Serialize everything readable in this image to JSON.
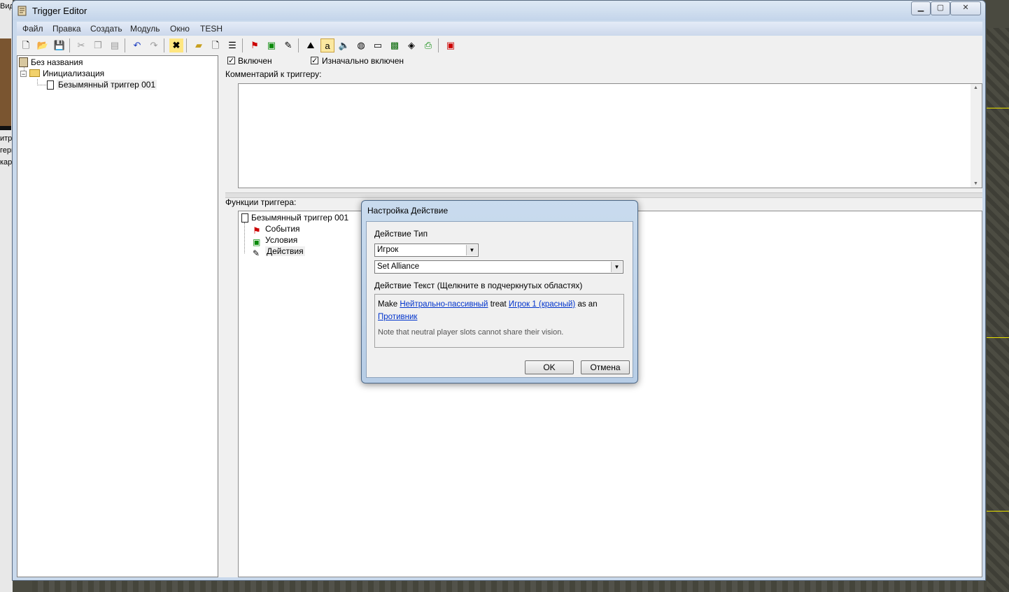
{
  "window": {
    "title": "Trigger Editor"
  },
  "menu": [
    "Файл",
    "Правка",
    "Создать",
    "Модуль",
    "Окно",
    "TESH"
  ],
  "background": {
    "left_labels": [
      "Вид",
      "итра",
      "герг",
      "кар"
    ]
  },
  "toolbar": {
    "icons": [
      "new-icon",
      "open-icon",
      "save-icon",
      "cut-icon",
      "copy-icon",
      "paste-icon",
      "undo-icon",
      "redo-icon",
      "delete-icon",
      "folder-icon",
      "trigger-icon",
      "comment-icon",
      "action-icon",
      "event-icon",
      "condition-icon",
      "terrain-icon",
      "units-icon",
      "sound-icon",
      "objects-icon",
      "doodads-icon",
      "regions-icon",
      "cameras-icon",
      "import-icon",
      "test-map-icon"
    ]
  },
  "trigger_tree": {
    "root": "Без названия",
    "folder": "Инициализация",
    "trigger": "Безымянный триггер 001"
  },
  "trigger_props": {
    "enabled_label": "Включен",
    "enabled_checked": true,
    "initially_on_label": "Изначально включен",
    "initially_on_checked": true,
    "comment_label": "Комментарий к триггеру:",
    "comment_value": "",
    "functions_label": "Функции триггера:"
  },
  "functions_tree": {
    "trigger": "Безымянный триггер 001",
    "events": "События",
    "conditions": "Условия",
    "actions": "Действия"
  },
  "dialog": {
    "title": "Настройка Действие",
    "type_label": "Действие Тип",
    "type_value": "Игрок",
    "action_value": "Set Alliance",
    "text_label": "Действие Текст (Щелкните в подчеркнутых областях)",
    "text_make": "Make",
    "text_player1": "Нейтрально-пассивный",
    "text_treat": "treat",
    "text_player2": "Игрок 1 (красный)",
    "text_as_an": "as an",
    "text_alliance": "Противник",
    "note": "Note that neutral player slots cannot share their vision.",
    "ok_label": "OK",
    "cancel_label": "Отмена"
  },
  "colors": {
    "accent": "#c9d9ec",
    "link": "#0033cc",
    "dialog_frame": "#b7cde6"
  }
}
